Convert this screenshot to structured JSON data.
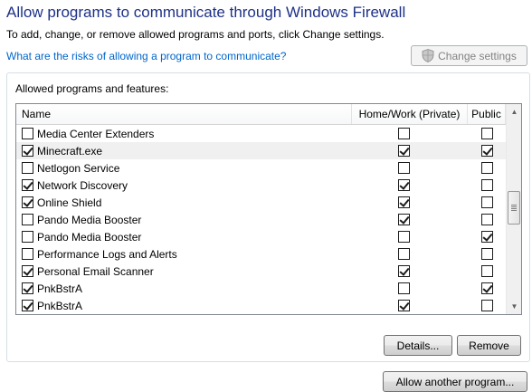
{
  "title": "Allow programs to communicate through Windows Firewall",
  "subtitle": "To add, change, or remove allowed programs and ports, click Change settings.",
  "risk_link": "What are the risks of allowing a program to communicate?",
  "change_settings_label": "Change settings",
  "group_label": "Allowed programs and features:",
  "columns": {
    "name": "Name",
    "private": "Home/Work (Private)",
    "public": "Public"
  },
  "rows": [
    {
      "name": "Media Center Extenders",
      "enabled": false,
      "private": false,
      "public": false
    },
    {
      "name": "Minecraft.exe",
      "enabled": true,
      "private": true,
      "public": true
    },
    {
      "name": "Netlogon Service",
      "enabled": false,
      "private": false,
      "public": false
    },
    {
      "name": "Network Discovery",
      "enabled": true,
      "private": true,
      "public": false
    },
    {
      "name": "Online Shield",
      "enabled": true,
      "private": true,
      "public": false
    },
    {
      "name": "Pando Media Booster",
      "enabled": false,
      "private": true,
      "public": false
    },
    {
      "name": "Pando Media Booster",
      "enabled": false,
      "private": false,
      "public": true
    },
    {
      "name": "Performance Logs and Alerts",
      "enabled": false,
      "private": false,
      "public": false
    },
    {
      "name": "Personal Email Scanner",
      "enabled": true,
      "private": true,
      "public": false
    },
    {
      "name": "PnkBstrA",
      "enabled": true,
      "private": false,
      "public": true
    },
    {
      "name": "PnkBstrA",
      "enabled": true,
      "private": true,
      "public": false
    },
    {
      "name": "PnkBstrB",
      "enabled": true,
      "private": false,
      "public": true
    }
  ],
  "selected_row": 1,
  "details_label": "Details...",
  "remove_label": "Remove",
  "allow_another_label": "Allow another program..."
}
